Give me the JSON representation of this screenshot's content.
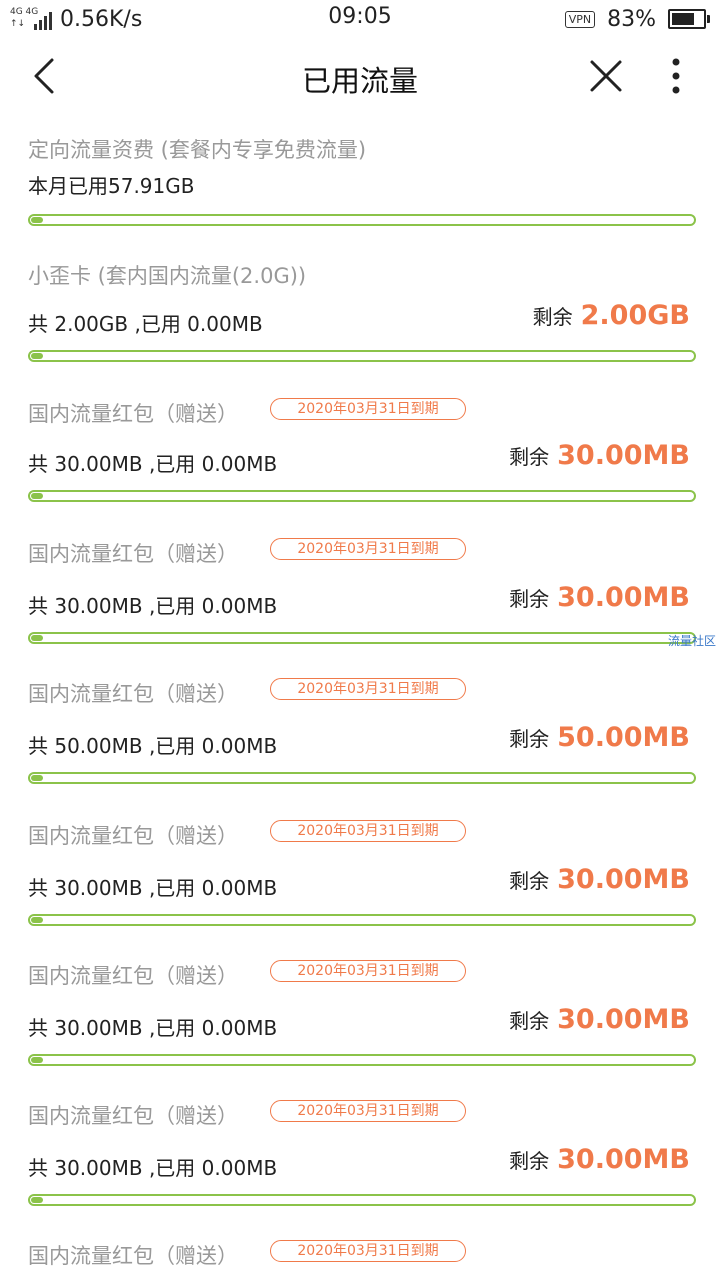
{
  "status_bar": {
    "network_top": "4G 4G",
    "network_bottom": "↑↓",
    "speed": "0.56K/s",
    "time": "09:05",
    "vpn": "VPN",
    "battery_percent": "83%",
    "battery_level": 0.83
  },
  "title_bar": {
    "title": "已用流量",
    "back_icon": "chevron-left-icon",
    "close_icon": "close-icon",
    "more_icon": "more-vertical-icon"
  },
  "colors": {
    "accent_orange": "#f07a4a",
    "progress_green": "#8bc34a"
  },
  "sections": [
    {
      "title": "定向流量资费 (套餐内专享免费流量)",
      "badge": "",
      "total_text": "本月已用57.91GB",
      "remain_label": "",
      "remain_value": "",
      "used_fraction": 0
    },
    {
      "title": "小歪卡 (套内国内流量(2.0G))",
      "badge": "",
      "total_text": "共 2.00GB ,已用 0.00MB",
      "remain_label": "剩余",
      "remain_value": "2.00GB",
      "used_fraction": 0
    },
    {
      "title": "国内流量红包（赠送）",
      "badge": "2020年03月31日到期",
      "total_text": "共 30.00MB ,已用 0.00MB",
      "remain_label": "剩余",
      "remain_value": "30.00MB",
      "used_fraction": 0
    },
    {
      "title": "国内流量红包（赠送）",
      "badge": "2020年03月31日到期",
      "total_text": "共 30.00MB ,已用 0.00MB",
      "remain_label": "剩余",
      "remain_value": "30.00MB",
      "used_fraction": 0
    },
    {
      "title": "国内流量红包（赠送）",
      "badge": "2020年03月31日到期",
      "total_text": "共 50.00MB ,已用 0.00MB",
      "remain_label": "剩余",
      "remain_value": "50.00MB",
      "used_fraction": 0
    },
    {
      "title": "国内流量红包（赠送）",
      "badge": "2020年03月31日到期",
      "total_text": "共 30.00MB ,已用 0.00MB",
      "remain_label": "剩余",
      "remain_value": "30.00MB",
      "used_fraction": 0
    },
    {
      "title": "国内流量红包（赠送）",
      "badge": "2020年03月31日到期",
      "total_text": "共 30.00MB ,已用 0.00MB",
      "remain_label": "剩余",
      "remain_value": "30.00MB",
      "used_fraction": 0
    },
    {
      "title": "国内流量红包（赠送）",
      "badge": "2020年03月31日到期",
      "total_text": "共 30.00MB ,已用 0.00MB",
      "remain_label": "剩余",
      "remain_value": "30.00MB",
      "used_fraction": 0
    },
    {
      "title": "国内流量红包（赠送）",
      "badge": "2020年03月31日到期",
      "total_text": "",
      "remain_label": "",
      "remain_value": "",
      "used_fraction": 0
    }
  ],
  "watermark": "流量社区"
}
